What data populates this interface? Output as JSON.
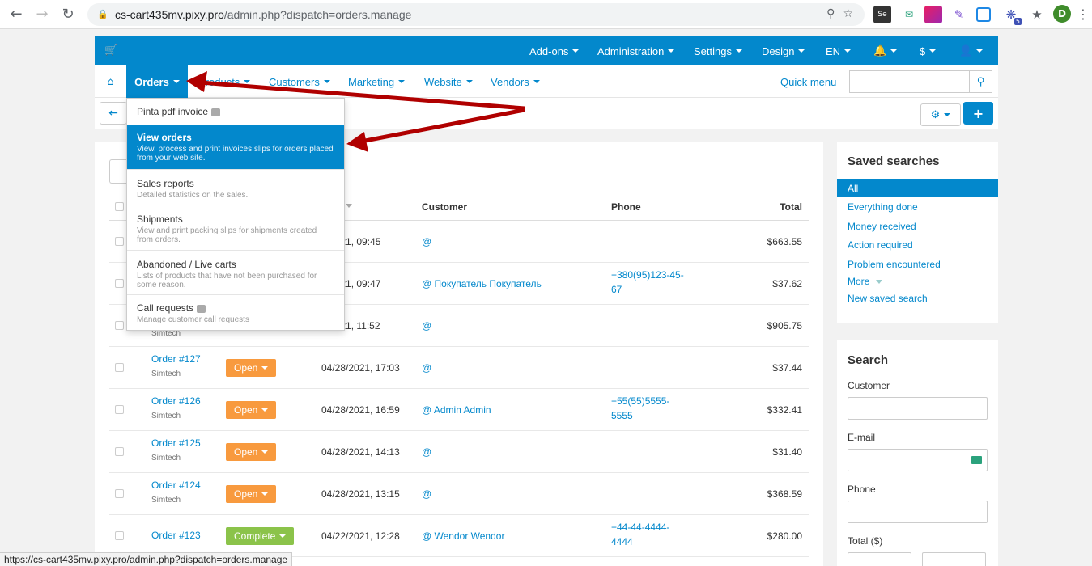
{
  "browser": {
    "url_domain": "cs-cart435mv.pixy.pro",
    "url_path": "/admin.php?dispatch=orders.manage",
    "status_url": "https://cs-cart435mv.pixy.pro/admin.php?dispatch=orders.manage",
    "profile_initial": "D",
    "ext_badge": "5"
  },
  "topbar": {
    "addons": "Add-ons",
    "administration": "Administration",
    "settings": "Settings",
    "design": "Design",
    "lang": "EN",
    "currency": "$"
  },
  "subnav": {
    "orders": "Orders",
    "products": "Products",
    "customers": "Customers",
    "marketing": "Marketing",
    "website": "Website",
    "vendors": "Vendors",
    "quick_menu": "Quick menu"
  },
  "dropdown": [
    {
      "title": "Pinta pdf invoice",
      "desc": ""
    },
    {
      "title": "View orders",
      "desc": "View, process and print invoices slips for orders placed from your web site."
    },
    {
      "title": "Sales reports",
      "desc": "Detailed statistics on the sales."
    },
    {
      "title": "Shipments",
      "desc": "View and print packing slips for shipments created from orders."
    },
    {
      "title": "Abandoned / Live carts",
      "desc": "Lists of products that have not been purchased for some reason."
    },
    {
      "title": "Call requests",
      "desc": "Manage customer call requests"
    }
  ],
  "table": {
    "headers": {
      "customer": "Customer",
      "phone": "Phone",
      "total": "Total"
    },
    "rows": [
      {
        "order": "",
        "vendor": "",
        "status": "",
        "date": "0/2021, 09:45",
        "customer": "@",
        "phone": "",
        "total": "$663.55"
      },
      {
        "order": "",
        "vendor": "",
        "status": "",
        "date": "6/2021, 09:47",
        "customer": "@ Покупатель Покупатель",
        "phone": "+380(95)123-45-67",
        "total": "$37.62"
      },
      {
        "order": "",
        "vendor": "Simtech",
        "status": "",
        "date": "9/2021, 11:52",
        "customer": "@",
        "phone": "",
        "total": "$905.75"
      },
      {
        "order": "Order #127",
        "vendor": "Simtech",
        "status": "Open",
        "date": "04/28/2021, 17:03",
        "customer": "@",
        "phone": "",
        "total": "$37.44"
      },
      {
        "order": "Order #126",
        "vendor": "Simtech",
        "status": "Open",
        "date": "04/28/2021, 16:59",
        "customer": "@ Admin Admin",
        "phone": "+55(55)5555-5555",
        "total": "$332.41"
      },
      {
        "order": "Order #125",
        "vendor": "Simtech",
        "status": "Open",
        "date": "04/28/2021, 14:13",
        "customer": "@",
        "phone": "",
        "total": "$31.40"
      },
      {
        "order": "Order #124",
        "vendor": "Simtech",
        "status": "Open",
        "date": "04/28/2021, 13:15",
        "customer": "@",
        "phone": "",
        "total": "$368.59"
      },
      {
        "order": "Order #123",
        "vendor": "",
        "status": "Complete",
        "date": "04/22/2021, 12:28",
        "customer": "@ Wendor Wendor",
        "phone": "+44-44-4444-4444",
        "total": "$280.00"
      }
    ]
  },
  "saved_searches": {
    "title": "Saved searches",
    "items": [
      "All",
      "Everything done",
      "Money received",
      "Action required",
      "Problem encountered",
      "More",
      "New saved search"
    ]
  },
  "search": {
    "title": "Search",
    "customer": "Customer",
    "email": "E-mail",
    "phone": "Phone",
    "total": "Total ($)"
  },
  "colors": {
    "accent": "#0388cc",
    "open": "#f89a3e",
    "complete": "#8bc34a",
    "arrow": "#b00000"
  },
  "icons": {
    "cart": "cart-icon",
    "home": "home-icon",
    "bell": "bell-icon",
    "user": "user-icon",
    "search": "search-icon",
    "gear": "gear-icon",
    "plus": "plus-icon",
    "back": "arrow-left-icon"
  }
}
